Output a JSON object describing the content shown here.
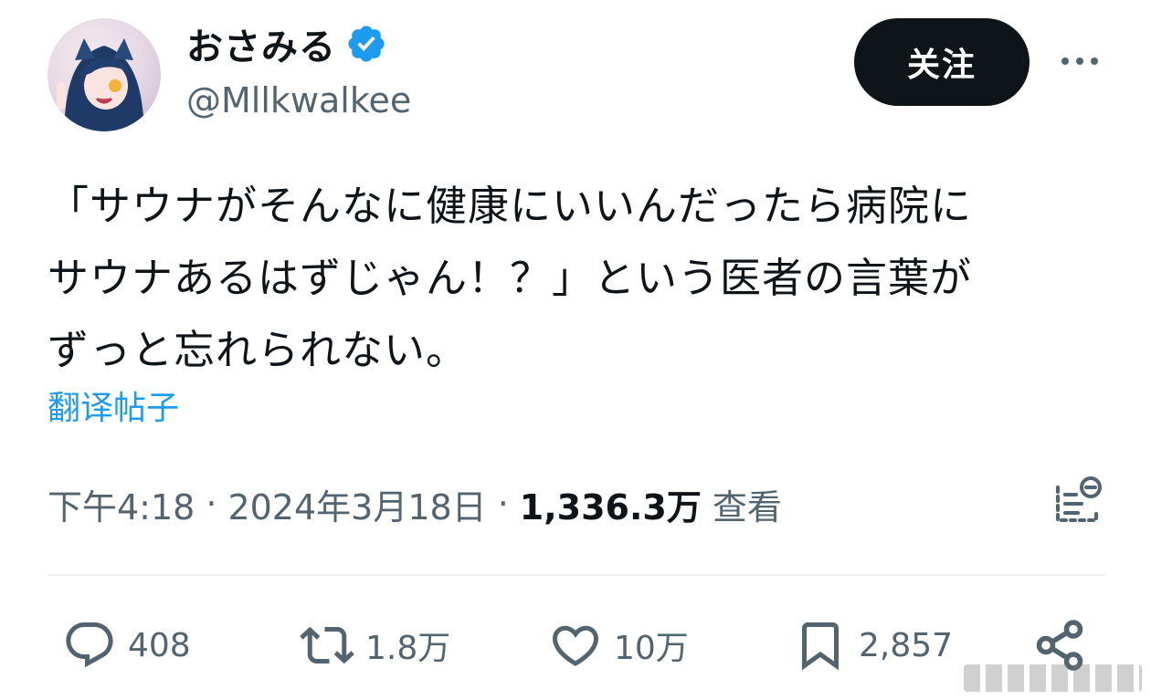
{
  "author": {
    "display_name": "おさみる",
    "handle": "@Mllkwalkee",
    "verified": true
  },
  "header": {
    "follow_label": "关注",
    "more_icon": "more-horizontal-icon"
  },
  "tweet": {
    "text": "「サウナがそんなに健康にいいんだったら病院に\nサウナあるはずじゃん！？」という医者の言葉が\nずっと忘れられない。",
    "translate_label": "翻译帖子"
  },
  "meta": {
    "time": "下午4:18",
    "date": "2024年3月18日",
    "views_count": "1,336.3万",
    "views_label": "查看",
    "separator": "·"
  },
  "actions": {
    "replies": "408",
    "retweets": "1.8万",
    "likes": "10万",
    "bookmarks": "2,857"
  },
  "colors": {
    "accent": "#1d9bf0",
    "text_primary": "#0f1419",
    "text_secondary": "#536471",
    "follow_button_bg": "#0f1419"
  }
}
